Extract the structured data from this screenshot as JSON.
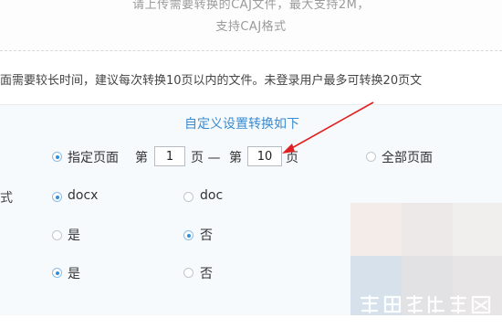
{
  "upload": {
    "hint_line1": "请上传需要转换的CAJ文件，最大支持2M，",
    "hint_line2": "支持CAJ格式"
  },
  "notice": {
    "text": "面需要较长时间，建议每次转换10页以内的文件。未登录用户最多可转换20页文"
  },
  "custom": {
    "title": "自定义设置转换如下"
  },
  "range": {
    "specify_label": "指定页面",
    "from_prefix": "第",
    "from_value": "1",
    "from_suffix": "页 —",
    "to_prefix": "第",
    "to_value": "10",
    "to_suffix": "页",
    "all_label": "全部页面"
  },
  "format": {
    "row_label": "式",
    "option1": "docx",
    "option2": "doc"
  },
  "row3": {
    "yes": "是",
    "no": "否"
  },
  "row4": {
    "yes": "是",
    "no": "否"
  },
  "watermark": {
    "text": "爱刨根知识网"
  },
  "colors": {
    "accent": "#2f8fe0",
    "link": "#3a8bd0",
    "arrow": "#e02020"
  }
}
